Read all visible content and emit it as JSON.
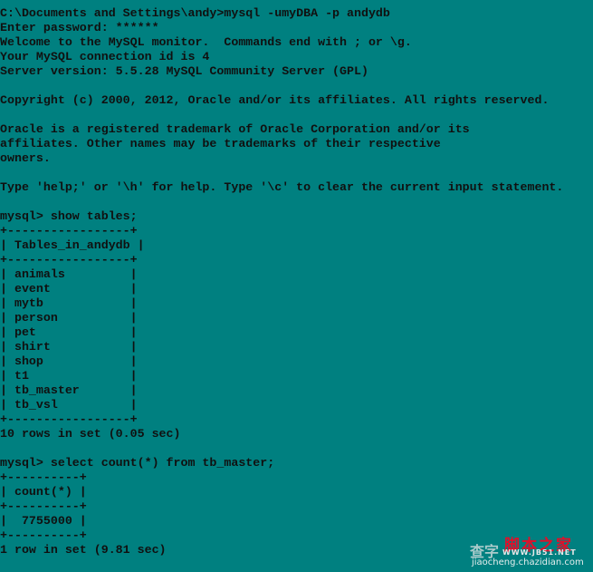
{
  "console": {
    "background": "#008080",
    "foreground": "#101010",
    "lines": [
      "C:\\Documents and Settings\\andy>mysql -umyDBA -p andydb",
      "Enter password: ******",
      "Welcome to the MySQL monitor.  Commands end with ; or \\g.",
      "Your MySQL connection id is 4",
      "Server version: 5.5.28 MySQL Community Server (GPL)",
      "",
      "Copyright (c) 2000, 2012, Oracle and/or its affiliates. All rights reserved.",
      "",
      "Oracle is a registered trademark of Oracle Corporation and/or its",
      "affiliates. Other names may be trademarks of their respective",
      "owners.",
      "",
      "Type 'help;' or '\\h' for help. Type '\\c' to clear the current input statement.",
      "",
      "mysql> show tables;",
      "+-----------------+",
      "| Tables_in_andydb |",
      "+-----------------+",
      "| animals         |",
      "| event           |",
      "| mytb            |",
      "| person          |",
      "| pet             |",
      "| shirt           |",
      "| shop            |",
      "| t1              |",
      "| tb_master       |",
      "| tb_vsl          |",
      "+-----------------+",
      "10 rows in set (0.05 sec)",
      "",
      "mysql> select count(*) from tb_master;",
      "+----------+",
      "| count(*) |",
      "+----------+",
      "|  7755000 |",
      "+----------+",
      "1 row in set (9.81 sec)"
    ]
  },
  "watermark": {
    "main": "脚本之家",
    "left": "查字",
    "url": "WWW.JB51.NET",
    "sub": "jiaocheng.chazidian.com"
  }
}
